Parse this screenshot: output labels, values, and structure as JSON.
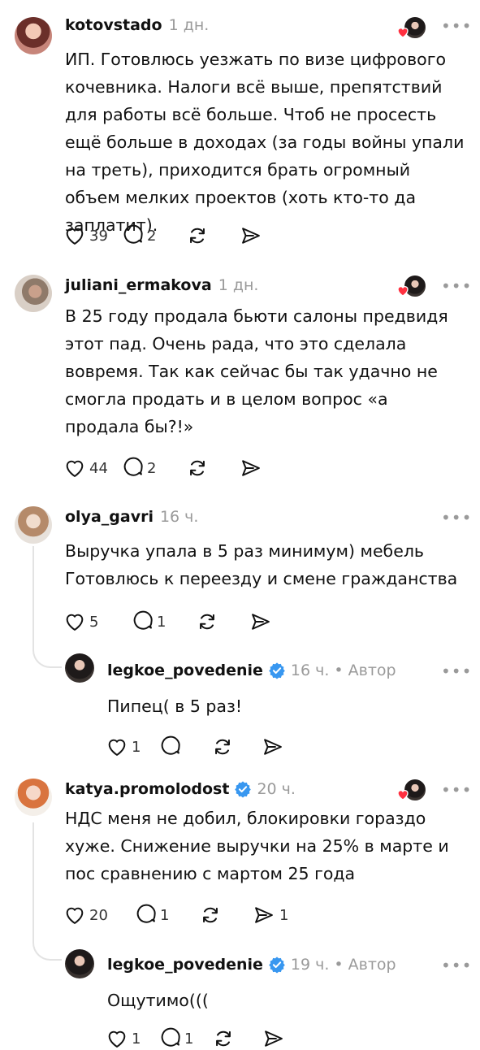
{
  "comments": [
    {
      "username": "kotovstado",
      "time": "1 дн.",
      "text": "ИП. Готовлюсь уезжать по визе цифрового кочевника. Налоги всё выше, препятствий для работы всё больше. Чтоб не просесть ещё больше в доходах (за годы войны упали на треть), приходится брать огромный объем мелких проектов (хоть кто-то да заплатит).",
      "likes": "39",
      "replies": "2",
      "reposts": "",
      "shares": ""
    },
    {
      "username": "juliani_ermakova",
      "time": "1 дн.",
      "text": "В 25 году продала бьюти салоны предвидя этот пад. Очень рада, что это сделала вовремя. Так как сейчас бы так удачно не смогла продать  и в целом вопрос «а продала бы?!»",
      "likes": "44",
      "replies": "2",
      "reposts": "",
      "shares": ""
    },
    {
      "username": "olya_gavri",
      "time": "16 ч.",
      "text": "Выручка упала в 5 раз минимум) мебель Готовлюсь к переезду и смене гражданства",
      "likes": "5",
      "replies": "1",
      "reposts": "",
      "shares": ""
    },
    {
      "username": "legkoe_povedenie",
      "time": "16 ч. • Автор",
      "text": "Пипец( в 5 раз!",
      "likes": "1",
      "replies": "",
      "reposts": "",
      "shares": ""
    },
    {
      "username": "katya.promolodost",
      "time": "20 ч.",
      "text": "НДС меня не добил, блокировки гораздо хуже. Снижение выручки на 25% в марте и пос сравнению с мартом 25 года",
      "likes": "20",
      "replies": "1",
      "reposts": "",
      "shares": "1"
    },
    {
      "username": "legkoe_povedenie",
      "time": "19 ч. • Автор",
      "text": "Ощутимо(((",
      "likes": "1",
      "replies": "1",
      "reposts": "",
      "shares": ""
    }
  ],
  "more_label": "•••",
  "colors": {
    "verified": "#3897f0",
    "heart_badge": "#ff3040",
    "muted": "#9a9a9a",
    "thread_line": "#e3e3e3"
  }
}
